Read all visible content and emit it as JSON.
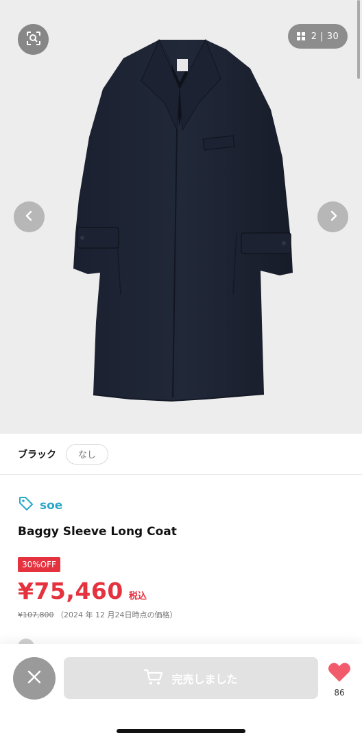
{
  "gallery": {
    "current": "2",
    "separator": "|",
    "total": "30",
    "icons": {
      "lens": "image-search-icon",
      "grid": "grid-icon",
      "prev": "chevron-left-icon",
      "next": "chevron-right-icon"
    }
  },
  "variant": {
    "color_label": "ブラック",
    "size_chip": "なし"
  },
  "product": {
    "brand": "soe",
    "title": "Baggy Sleeve Long Coat",
    "discount_badge": "30%OFF",
    "price": "¥75,460",
    "tax_label": "税込",
    "original_price": "¥107,800",
    "price_note": "（2024 年 12 月24日時点の価格）"
  },
  "bottom_bar": {
    "soldout_label": "完売しました",
    "like_count": "86"
  },
  "colors": {
    "accent": "#e5323f",
    "brand": "#2aa6c8"
  }
}
